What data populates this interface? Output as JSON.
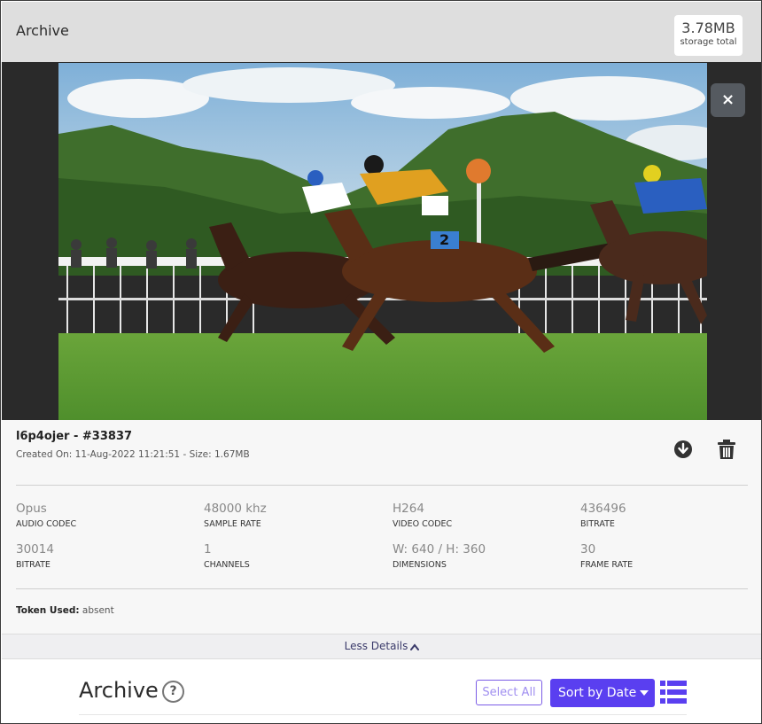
{
  "header": {
    "title": "Archive",
    "storage_value": "3.78MB",
    "storage_label": "storage total"
  },
  "viewer": {
    "image_subject": "horse race photo",
    "close_symbol": "×",
    "close_icon": "close-icon"
  },
  "file": {
    "name": "l6p4ojer - #33837",
    "meta": "Created On: 11-Aug-2022 11:21:51 - Size: 1.67MB",
    "download_icon": "download-circle-icon",
    "delete_icon": "trash-icon"
  },
  "specs": [
    {
      "value": "Opus",
      "label": "AUDIO CODEC"
    },
    {
      "value": "48000 khz",
      "label": "SAMPLE RATE"
    },
    {
      "value": "H264",
      "label": "VIDEO CODEC"
    },
    {
      "value": "436496",
      "label": "BITRATE"
    },
    {
      "value": "30014",
      "label": "BITRATE"
    },
    {
      "value": "1",
      "label": "CHANNELS"
    },
    {
      "value": "W: 640 / H: 360",
      "label": "DIMENSIONS"
    },
    {
      "value": "30",
      "label": "FRAME RATE"
    }
  ],
  "token": {
    "label": "Token Used:",
    "value": "absent"
  },
  "toggle": {
    "label": "Less Details"
  },
  "archive": {
    "title": "Archive",
    "help_symbol": "?",
    "select_all": "Select All",
    "sort_label": "Sort by Date"
  },
  "colors": {
    "accent": "#5a3ff0",
    "accent_outline": "#7b5ce6",
    "stage": "#2a2a2a",
    "header_bg": "#dedede"
  }
}
